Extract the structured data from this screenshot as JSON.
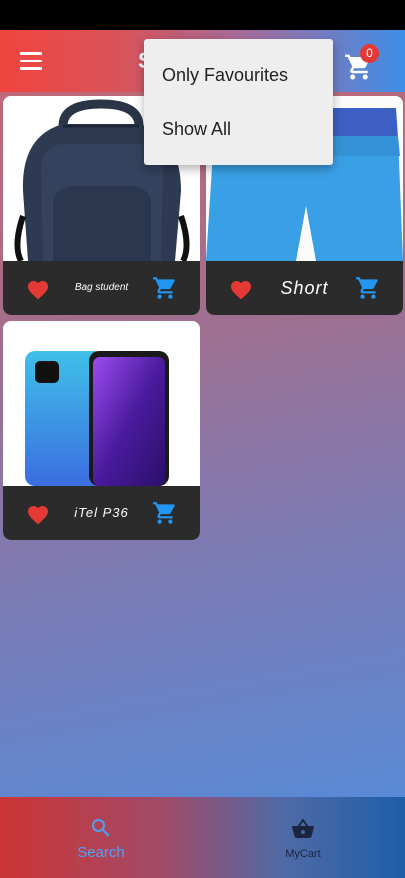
{
  "app_bar": {
    "title": "S",
    "cart_count": "0"
  },
  "menu": {
    "items": [
      {
        "label": "Only Favourites"
      },
      {
        "label": "Show All"
      }
    ]
  },
  "products": [
    {
      "name": "Bag student",
      "image": "backpack"
    },
    {
      "name": "Short",
      "image": "blue-shorts"
    },
    {
      "name": "iTel P36",
      "image": "smartphone"
    }
  ],
  "bottom_nav": {
    "items": [
      {
        "label": "Search",
        "icon": "search-icon",
        "active": true
      },
      {
        "label": "MyCart",
        "icon": "shopping-basket-icon",
        "active": false
      }
    ]
  },
  "colors": {
    "favorite": "#e53935",
    "cart_accent": "#2196f3",
    "nav_active": "#4aa3f5",
    "nav_inactive": "#1c2540"
  }
}
